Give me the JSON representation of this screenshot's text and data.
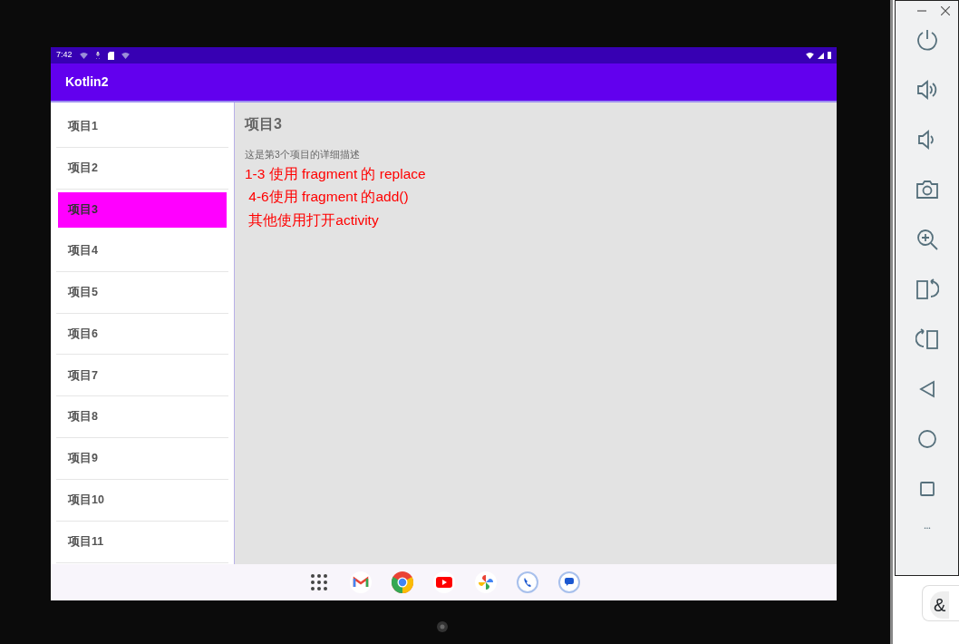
{
  "status_bar": {
    "time": "7:42"
  },
  "app_bar": {
    "title": "Kotlin2"
  },
  "list": [
    {
      "label": "项目1",
      "selected": false
    },
    {
      "label": "项目2",
      "selected": false
    },
    {
      "label": "项目3",
      "selected": true
    },
    {
      "label": "项目4",
      "selected": false
    },
    {
      "label": "项目5",
      "selected": false
    },
    {
      "label": "项目6",
      "selected": false
    },
    {
      "label": "项目7",
      "selected": false
    },
    {
      "label": "项目8",
      "selected": false
    },
    {
      "label": "项目9",
      "selected": false
    },
    {
      "label": "项目10",
      "selected": false
    },
    {
      "label": "项目11",
      "selected": false
    }
  ],
  "detail": {
    "title": "项目3",
    "description": "这是第3个项目的详细描述",
    "notes": [
      "1-3 使用 fragment 的 replace",
      " 4-6使用 fragment 的add()",
      " 其他使用打开activity"
    ]
  },
  "background_fragment": "&"
}
